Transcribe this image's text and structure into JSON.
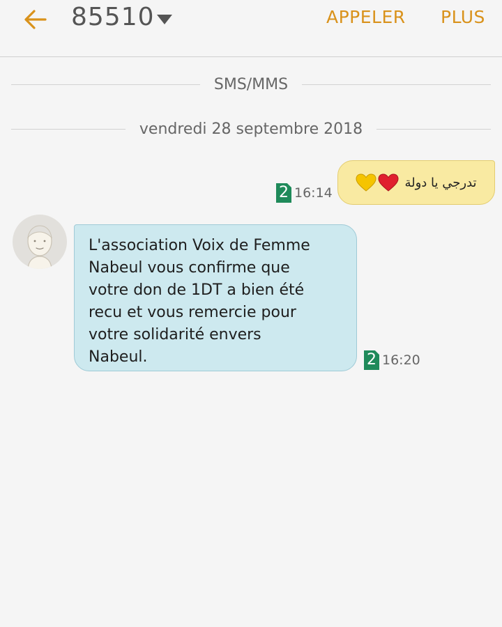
{
  "appbar": {
    "title": "85510",
    "call_label": "APPELER",
    "more_label": "PLUS",
    "accent_color": "#d9921b"
  },
  "thread": {
    "channel_label": "SMS/MMS",
    "date_label": "vendredi 28 septembre 2018"
  },
  "messages": [
    {
      "direction": "outgoing",
      "text": "تدرجي يا دولة",
      "emoji": [
        "red-heart-icon",
        "yellow-heart-icon"
      ],
      "sim": "2",
      "time": "16:14",
      "bubble_color": "#f9eaa2"
    },
    {
      "direction": "incoming",
      "text": "L'association Voix de Femme\nNabeul vous confirme que\nvotre don de 1DT a bien été\nrecu et vous remercie pour\nvotre solidarité envers\nNabeul.",
      "sim": "2",
      "time": "16:20",
      "bubble_color": "#cde9ef"
    }
  ]
}
